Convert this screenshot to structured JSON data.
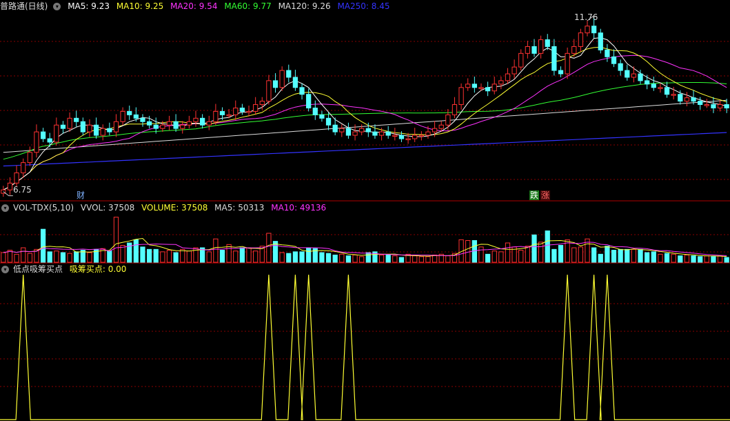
{
  "main_header": {
    "title": "普路通(日线)",
    "ma5": "MA5: 9.23",
    "ma10": "MA10: 9.25",
    "ma20": "MA20: 9.54",
    "ma60": "MA60: 9.77",
    "ma120": "MA120: 9.26",
    "ma250": "MA250: 8.45"
  },
  "volume_header": {
    "name": "VOL-TDX(5,10)",
    "vvol": "VVOL: 37508",
    "volume": "VOLUME: 37508",
    "ma5": "MA5: 50313",
    "ma10": "MA10: 49136"
  },
  "signal_header": {
    "name": "低点吸筹买点",
    "value": "吸筹买点: 0.00"
  },
  "annotations": {
    "high": "11.76",
    "low": "6.75",
    "tag_cai": "财",
    "tag_die": "跌",
    "tag_zhang": "涨"
  },
  "colors": {
    "background": "#000000",
    "up": "#ff3232",
    "down": "#54ffff",
    "ma5": "#ffffff",
    "ma10": "#ffff33",
    "ma20": "#ff33ff",
    "ma60": "#33ff33",
    "ma120": "#dddddd",
    "ma250": "#3333ff",
    "grid": "#8b0000",
    "signal": "#ffff33"
  },
  "chart_data": [
    {
      "type": "candlestick",
      "title": "普路通(日线)",
      "ylim": [
        6.5,
        12.0
      ],
      "high_label": 11.76,
      "low_label": 6.75,
      "moving_averages": [
        "MA5",
        "MA10",
        "MA20",
        "MA60",
        "MA120",
        "MA250"
      ],
      "close": [
        6.8,
        7.0,
        7.3,
        7.6,
        7.9,
        8.5,
        8.3,
        8.2,
        8.7,
        8.6,
        8.9,
        8.8,
        8.5,
        8.7,
        8.4,
        8.6,
        8.5,
        8.8,
        9.1,
        9.0,
        8.9,
        8.8,
        8.7,
        8.6,
        8.7,
        8.8,
        8.6,
        8.7,
        8.8,
        8.9,
        8.7,
        8.8,
        9.1,
        9.0,
        9.0,
        9.2,
        9.1,
        9.1,
        9.3,
        9.4,
        10.0,
        9.8,
        10.3,
        10.1,
        9.8,
        9.6,
        9.2,
        9.0,
        8.9,
        8.7,
        8.5,
        8.6,
        8.4,
        8.5,
        8.6,
        8.5,
        8.4,
        8.5,
        8.4,
        8.4,
        8.3,
        8.3,
        8.4,
        8.4,
        8.5,
        8.6,
        8.7,
        9.0,
        9.3,
        9.8,
        9.9,
        9.8,
        9.8,
        9.7,
        9.9,
        10.0,
        10.2,
        10.4,
        10.8,
        11.0,
        10.8,
        11.2,
        11.0,
        10.3,
        10.2,
        10.8,
        11.0,
        11.4,
        11.6,
        11.4,
        10.9,
        10.7,
        10.5,
        10.3,
        10.1,
        10.2,
        10.0,
        9.9,
        9.8,
        9.8,
        9.6,
        9.6,
        9.4,
        9.5,
        9.4,
        9.3,
        9.3,
        9.2,
        9.3,
        9.2
      ],
      "volume": [
        1.2,
        1.5,
        1.0,
        1.8,
        1.1,
        1.6,
        4.1,
        1.3,
        1.4,
        1.2,
        1.1,
        1.3,
        1.5,
        1.2,
        1.6,
        1.7,
        1.4,
        5.6,
        2.1,
        2.4,
        2.8,
        1.9,
        1.6,
        1.6,
        1.3,
        1.5,
        1.2,
        1.6,
        1.4,
        1.8,
        1.8,
        1.3,
        2.9,
        1.5,
        2.2,
        1.4,
        1.8,
        1.8,
        1.4,
        2.0,
        3.6,
        2.6,
        1.2,
        1.1,
        1.3,
        1.3,
        1.8,
        1.7,
        1.2,
        1.1,
        0.9,
        1.0,
        0.8,
        0.9,
        0.7,
        1.2,
        1.3,
        0.9,
        0.9,
        0.8,
        0.6,
        1.0,
        0.8,
        0.7,
        0.7,
        0.9,
        1.0,
        0.8,
        1.1,
        2.8,
        2.7,
        2.7,
        1.9,
        1.0,
        1.4,
        1.3,
        2.4,
        1.9,
        1.5,
        2.0,
        3.4,
        2.5,
        3.9,
        1.6,
        2.1,
        2.8,
        1.8,
        1.9,
        2.9,
        1.8,
        1.0,
        2.0,
        1.5,
        1.6,
        1.6,
        1.6,
        1.6,
        1.2,
        1.3,
        1.0,
        1.1,
        1.0,
        0.8,
        0.9,
        0.8,
        0.7,
        0.8,
        0.7,
        0.8,
        0.6
      ],
      "signal_peaks": [
        3,
        40,
        44,
        46,
        52,
        85,
        89,
        91
      ]
    }
  ]
}
